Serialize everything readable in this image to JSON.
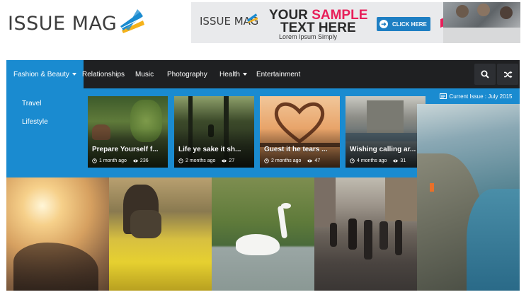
{
  "brand": {
    "logo_text": "ISSUE MAG"
  },
  "ad": {
    "brand_text": "ISSUE MAG",
    "headline_prefix": "YOUR ",
    "headline_accent": "SAMPLE",
    "headline_line2": "TEXT HERE",
    "subtext": "Lorem Ipsum Simply",
    "button_label": "CLICK HERE",
    "accent_color": "#e8205a",
    "button_color": "#1e7fc3"
  },
  "nav": {
    "items": [
      {
        "label": "Fashion & Beauty",
        "has_caret": true,
        "active": true
      },
      {
        "label": "Relationships"
      },
      {
        "label": "Music"
      },
      {
        "label": "Photography"
      },
      {
        "label": "Health",
        "has_caret": true
      },
      {
        "label": "Entertainment"
      }
    ],
    "search_icon": "search-icon",
    "shuffle_icon": "shuffle-icon",
    "bg_color": "#1f2022",
    "active_color": "#1a8bd0"
  },
  "mega_menu": {
    "subcategories": [
      "Travel",
      "Lifestyle"
    ],
    "cards": [
      {
        "title": "Prepare Yourself f...",
        "time": "1 month ago",
        "views": "236"
      },
      {
        "title": "Life ye sake it sh...",
        "time": "2 months ago",
        "views": "27"
      },
      {
        "title": "Guest it he tears ...",
        "time": "2 months ago",
        "views": "47"
      },
      {
        "title": "Wishing calling ar...",
        "time": "4 months ago",
        "views": "31"
      }
    ]
  },
  "current_issue": {
    "label": "Current Issue : July 2015"
  }
}
